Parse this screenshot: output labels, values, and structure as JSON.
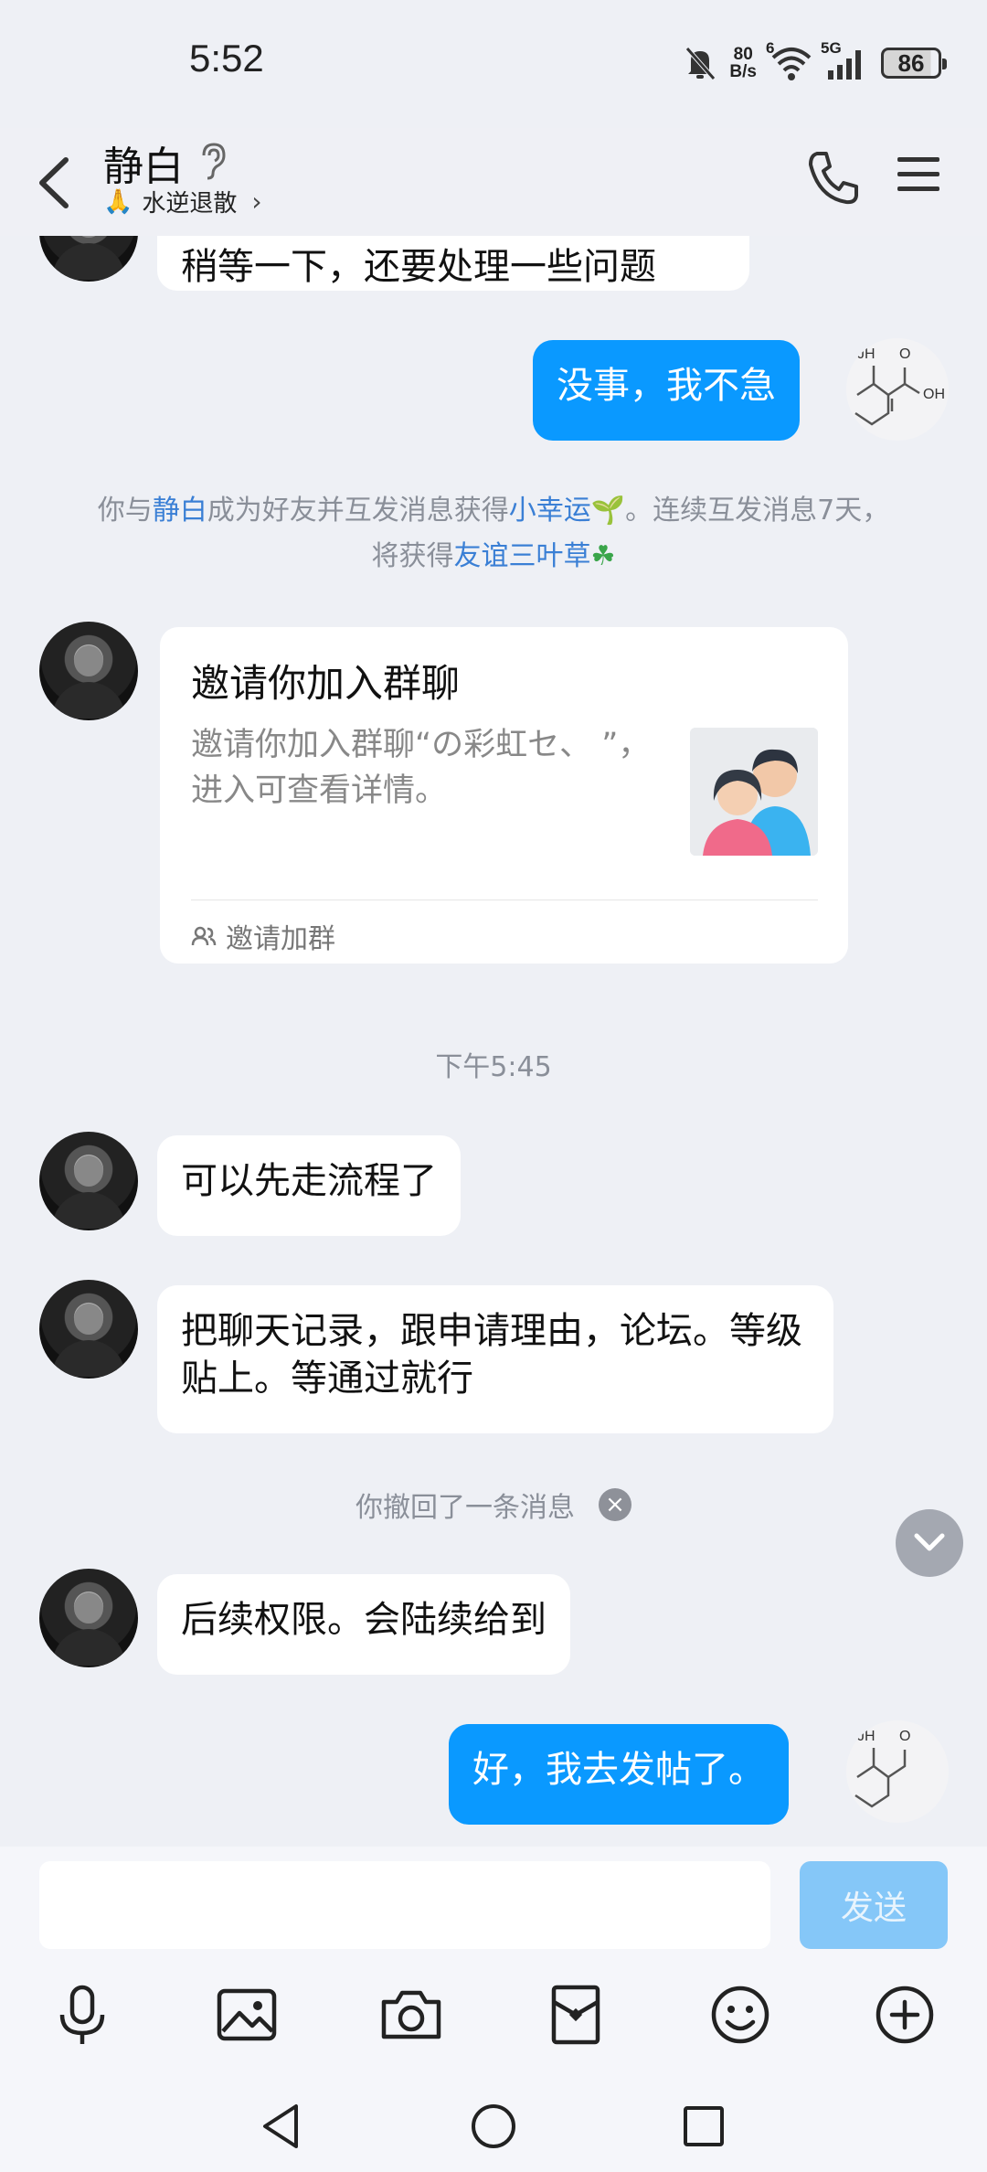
{
  "status_bar": {
    "time": "5:52",
    "net_speed_value": "80",
    "net_speed_unit": "B/s",
    "wifi_label": "6",
    "cell_label": "5G",
    "battery": "86"
  },
  "header": {
    "name": "静白",
    "status_emoji": "🙏",
    "status_text": "水逆退散",
    "status_chevron": "›"
  },
  "messages": {
    "m0": "稍等一下，还要处理一些问题",
    "m1": "没事，我不急",
    "m3": "可以先走流程了",
    "m4": "把聊天记录，跟申请理由，论坛。等级贴上。等通过就行",
    "m5": "后续权限。会陆续给到",
    "m6": "好，我去发帖了。"
  },
  "system_notice": {
    "p1": "你与",
    "name": "静白",
    "p2": "成为好友并互发消息获得",
    "luck": "小幸运",
    "luck_emoji": "🌱",
    "p3": "。连续互发消息7天，",
    "p4": "将获得",
    "clover": "友谊三叶草",
    "clover_emoji": "☘"
  },
  "invite_card": {
    "title": "邀请你加入群聊",
    "desc": "邀请你加入群聊“の彩虹セ、                    ”，进入可查看详情。",
    "footer": "邀请加群"
  },
  "time_label": "下午5:45",
  "revoke_text": "你撤回了一条消息",
  "revoke_close": "×",
  "input": {
    "placeholder": "",
    "send_label": "发送"
  },
  "colors": {
    "out_bubble": "#0a99ff",
    "link": "#3a7fd5",
    "send_disabled": "#85c7f8"
  }
}
